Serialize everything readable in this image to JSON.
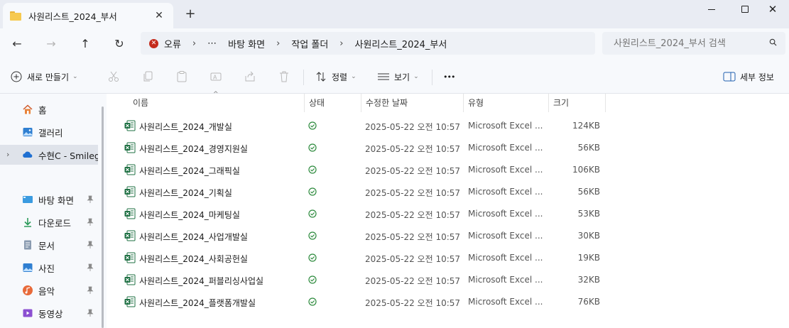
{
  "window": {
    "tab_title": "사원리스트_2024_부서",
    "tab_close": "✕",
    "new_tab": "+",
    "close_glyph": "✕"
  },
  "nav": {
    "back": "←",
    "forward": "→",
    "up": "↑",
    "refresh": "↻"
  },
  "address": {
    "status": "오류",
    "overflow": "⋯",
    "separator": "›",
    "crumbs": [
      "바탕 화면",
      "작업 폴더",
      "사원리스트_2024_부서"
    ]
  },
  "search": {
    "placeholder": "사원리스트_2024_부서 검색"
  },
  "commands": {
    "new_label": "새로 만들기",
    "sort_label": "정렬",
    "view_label": "보기",
    "more": "•••",
    "details_label": "세부 정보",
    "chevron": "⌄"
  },
  "sidebar": {
    "items": [
      {
        "label": "홈",
        "icon": "home-icon"
      },
      {
        "label": "갤러리",
        "icon": "gallery-icon"
      },
      {
        "label": "수현C - Smilegate",
        "icon": "onedrive-icon"
      },
      {
        "label": "바탕 화면",
        "icon": "desktop-icon"
      },
      {
        "label": "다운로드",
        "icon": "download-icon"
      },
      {
        "label": "문서",
        "icon": "document-icon"
      },
      {
        "label": "사진",
        "icon": "pictures-icon"
      },
      {
        "label": "음악",
        "icon": "music-icon"
      },
      {
        "label": "동영상",
        "icon": "video-icon"
      }
    ],
    "expand_glyph": "›"
  },
  "columns": {
    "name": "이름",
    "status": "상태",
    "date": "수정한 날짜",
    "type": "유형",
    "size": "크기",
    "sort_glyph": "^"
  },
  "files": [
    {
      "name": "사원리스트_2024_개발실",
      "date": "2025-05-22 오전 10:57",
      "type": "Microsoft Excel ...",
      "size": "124KB"
    },
    {
      "name": "사원리스트_2024_경영지원실",
      "date": "2025-05-22 오전 10:57",
      "type": "Microsoft Excel ...",
      "size": "56KB"
    },
    {
      "name": "사원리스트_2024_그래픽실",
      "date": "2025-05-22 오전 10:57",
      "type": "Microsoft Excel ...",
      "size": "106KB"
    },
    {
      "name": "사원리스트_2024_기획실",
      "date": "2025-05-22 오전 10:57",
      "type": "Microsoft Excel ...",
      "size": "56KB"
    },
    {
      "name": "사원리스트_2024_마케팅실",
      "date": "2025-05-22 오전 10:57",
      "type": "Microsoft Excel ...",
      "size": "53KB"
    },
    {
      "name": "사원리스트_2024_사업개발실",
      "date": "2025-05-22 오전 10:57",
      "type": "Microsoft Excel ...",
      "size": "30KB"
    },
    {
      "name": "사원리스트_2024_사회공헌실",
      "date": "2025-05-22 오전 10:57",
      "type": "Microsoft Excel ...",
      "size": "19KB"
    },
    {
      "name": "사원리스트_2024_퍼블리싱사업실",
      "date": "2025-05-22 오전 10:57",
      "type": "Microsoft Excel ...",
      "size": "32KB"
    },
    {
      "name": "사원리스트_2024_플랫폼개발실",
      "date": "2025-05-22 오전 10:57",
      "type": "Microsoft Excel ...",
      "size": "76KB"
    }
  ],
  "colors": {
    "excel_green": "#1d6f42",
    "status_green": "#2e8b3e",
    "error_red": "#c42b1c",
    "folder_yellow": "#f6c94f"
  }
}
